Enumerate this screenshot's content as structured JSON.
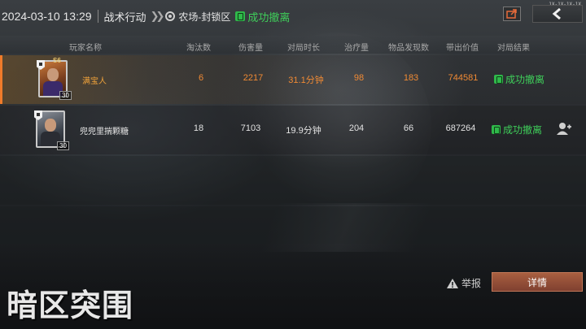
{
  "topbar": {
    "date": "2024-03-10 13:29",
    "mode": "战术行动",
    "map": "农场-封锁区",
    "result": "成功撤离",
    "tiny_text": "1X-1X-1X-1X"
  },
  "table": {
    "headers": [
      "玩家名称",
      "淘汰数",
      "伤害量",
      "对局时长",
      "治疗量",
      "物品发现数",
      "带出价值",
      "对局结果"
    ],
    "rows": [
      {
        "name": "满宝人",
        "kills": "6",
        "damage": "2217",
        "duration": "31.1分钟",
        "heal": "98",
        "items": "183",
        "value": "744581",
        "result": "成功撤离",
        "level": "30",
        "highlight": true
      },
      {
        "name": "兜兜里揣颗糖",
        "kills": "18",
        "damage": "7103",
        "duration": "19.9分钟",
        "heal": "204",
        "items": "66",
        "value": "687264",
        "result": "成功撤离",
        "level": "30",
        "highlight": false
      }
    ]
  },
  "footer": {
    "report": "举报",
    "detail": "详情",
    "logo": "暗区突围"
  },
  "colors": {
    "accent_orange": "#f07b2a",
    "success_green": "#3fce5a",
    "detail_button": "#a95f40"
  }
}
